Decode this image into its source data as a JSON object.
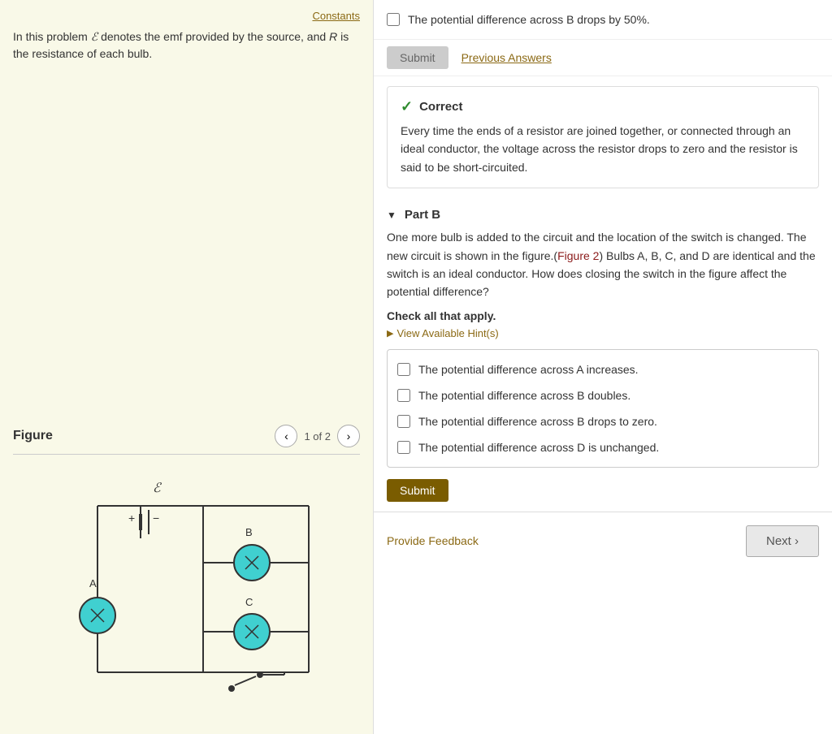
{
  "left": {
    "constants_link": "Constants",
    "problem_text_1": "In this problem ",
    "emf_symbol": "ℰ",
    "problem_text_2": " denotes the emf provided by the source, and ",
    "r_symbol": "R",
    "problem_text_3": " is the resistance of each bulb.",
    "figure_title": "Figure",
    "nav_count": "1 of 2"
  },
  "right": {
    "answer_option_top": "The potential difference across B drops by 50%.",
    "submit_disabled_label": "Submit",
    "previous_answers_label": "Previous Answers",
    "correct": {
      "header": "Correct",
      "check_symbol": "✓",
      "body": "Every time the ends of a resistor are joined together, or connected through an ideal conductor, the voltage across the resistor drops to zero and the resistor is said to be short-circuited."
    },
    "part_b": {
      "label": "Part B",
      "description_1": "One more bulb is added to the circuit and the location of the switch is changed. The new circuit is shown in the figure.(",
      "figure_ref": "Figure 2",
      "description_2": ") Bulbs A, B, C, and D are identical and the switch is an ideal conductor. How does closing the switch in the figure affect the potential difference?",
      "check_all": "Check all that apply.",
      "view_hints": "View Available Hint(s)",
      "options": [
        "The potential difference across A increases.",
        "The potential difference across B doubles.",
        "The potential difference across B drops to zero.",
        "The potential difference across D is unchanged."
      ],
      "submit_label": "Submit"
    },
    "provide_feedback": "Provide Feedback",
    "next_label": "Next ›"
  }
}
